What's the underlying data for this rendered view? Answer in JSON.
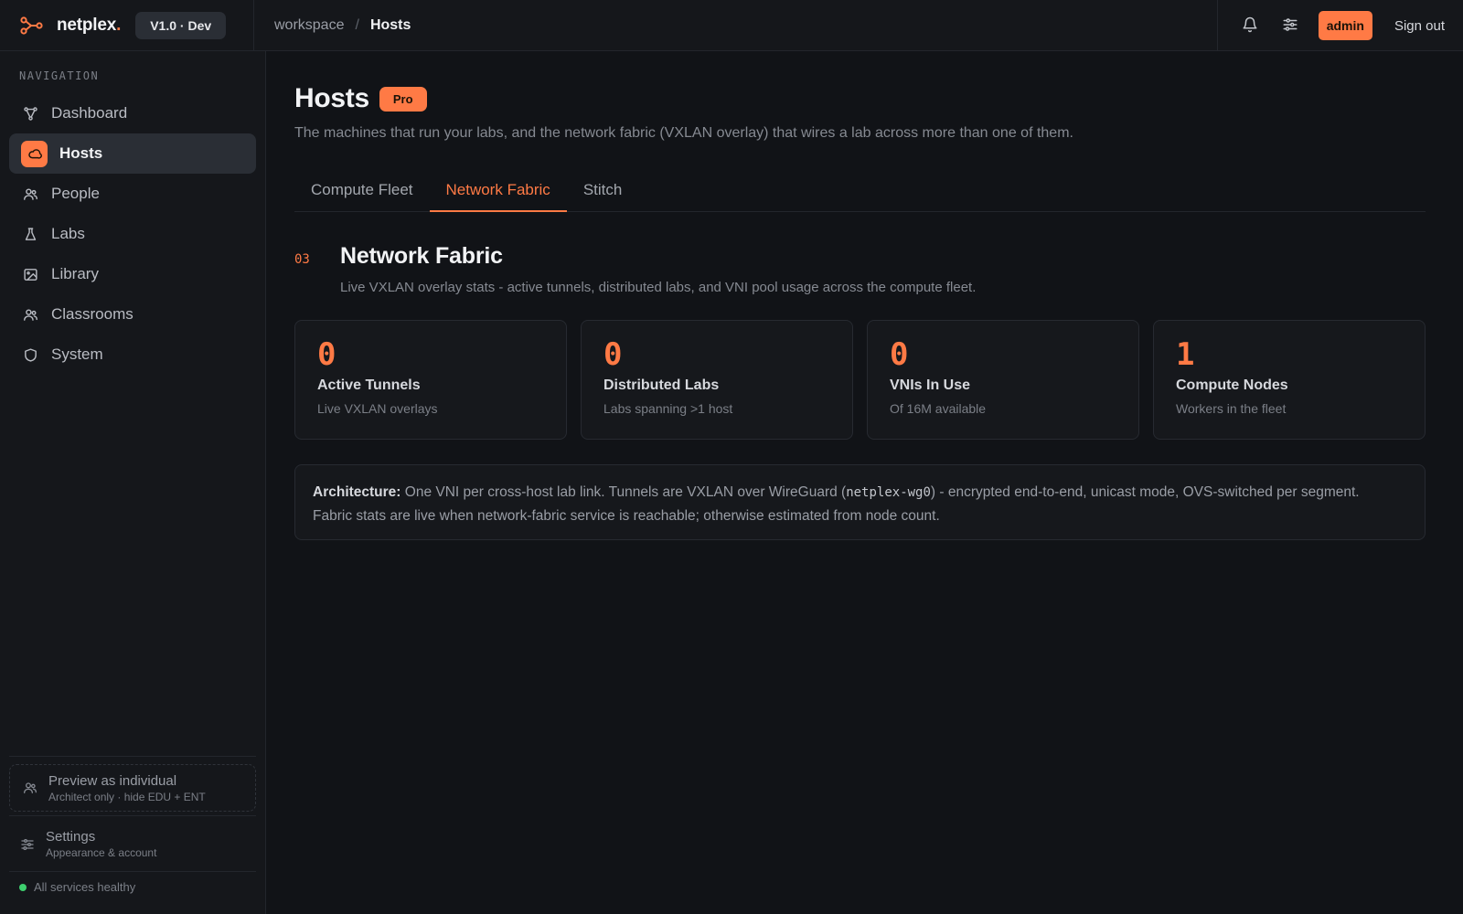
{
  "app": {
    "name": "netplex",
    "name_dot": ".",
    "version": "V1.0 · Dev"
  },
  "breadcrumb": {
    "root": "workspace",
    "separator": "/",
    "current": "Hosts"
  },
  "topbar": {
    "notifications_icon": "bell-icon",
    "preferences_icon": "sliders-icon",
    "role_badge": "admin",
    "sign_out": "Sign out"
  },
  "sidebar": {
    "heading": "NAVIGATION",
    "items": [
      {
        "label": "Dashboard",
        "icon": "graph-icon",
        "active": false
      },
      {
        "label": "Hosts",
        "icon": "cloud-icon",
        "active": true
      },
      {
        "label": "People",
        "icon": "users-icon",
        "active": false
      },
      {
        "label": "Labs",
        "icon": "flask-icon",
        "active": false
      },
      {
        "label": "Library",
        "icon": "image-icon",
        "active": false
      },
      {
        "label": "Classrooms",
        "icon": "users-icon",
        "active": false
      },
      {
        "label": "System",
        "icon": "shield-icon",
        "active": false
      }
    ],
    "preview": {
      "title": "Preview as individual",
      "subtitle": "Architect only · hide EDU + ENT"
    },
    "settings": {
      "title": "Settings",
      "subtitle": "Appearance & account"
    },
    "status": "All services healthy"
  },
  "page": {
    "title": "Hosts",
    "badge": "Pro",
    "description": "The machines that run your labs, and the network fabric (VXLAN overlay) that wires a lab across more than one of them."
  },
  "tabs": [
    {
      "label": "Compute Fleet",
      "active": false
    },
    {
      "label": "Network Fabric",
      "active": true
    },
    {
      "label": "Stitch",
      "active": false
    }
  ],
  "section": {
    "number": "03",
    "title": "Network Fabric",
    "subtitle": "Live VXLAN overlay stats - active tunnels, distributed labs, and VNI pool usage across the compute fleet."
  },
  "stats": [
    {
      "value": "0",
      "label": "Active Tunnels",
      "sub": "Live VXLAN overlays"
    },
    {
      "value": "0",
      "label": "Distributed Labs",
      "sub": "Labs spanning >1 host"
    },
    {
      "value": "0",
      "label": "VNIs In Use",
      "sub": "Of 16M available"
    },
    {
      "value": "1",
      "label": "Compute Nodes",
      "sub": "Workers in the fleet"
    }
  ],
  "architecture": {
    "label": "Architecture:",
    "text_before": " One VNI per cross-host lab link. Tunnels are VXLAN over WireGuard (",
    "code": "netplex-wg0",
    "text_after": ") - encrypted end-to-end, unicast mode, OVS-switched per segment.",
    "line2": "Fabric stats are live when network-fabric service is reachable; otherwise estimated from node count."
  },
  "colors": {
    "accent": "#ff7a45",
    "background": "#111317",
    "sidebar": "#15171b",
    "healthy": "#3ecf6e"
  }
}
